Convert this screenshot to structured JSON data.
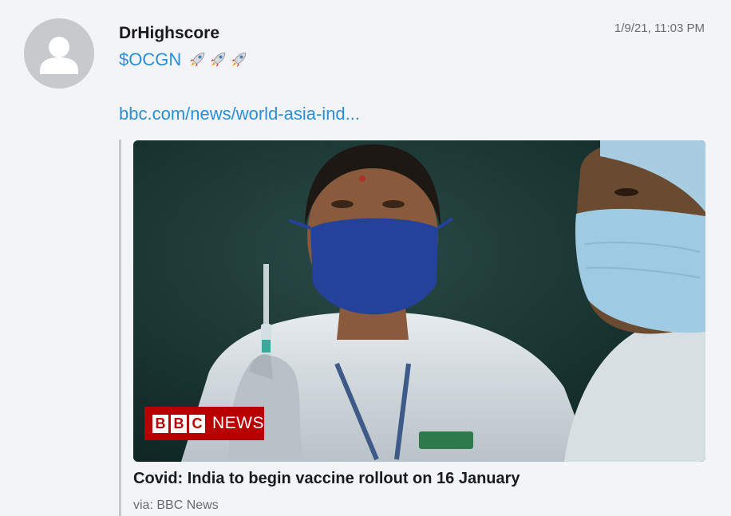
{
  "post": {
    "username": "DrHighscore",
    "timestamp": "1/9/21, 11:03 PM",
    "ticker": "$OCGN",
    "rockets": [
      "rocket-icon",
      "rocket-icon",
      "rocket-icon"
    ],
    "link": "bbc.com/news/world-asia-ind..."
  },
  "card": {
    "image": "health-worker-holding-vaccine-syringe",
    "logo": {
      "letters": [
        "B",
        "B",
        "C"
      ],
      "word": "NEWS"
    },
    "title": "Covid: India to begin vaccine rollout on 16 January",
    "via": "via: BBC News"
  },
  "colors": {
    "link": "#2a8fd6",
    "background": "#f3f4f8",
    "bbc_red": "#b80000"
  }
}
